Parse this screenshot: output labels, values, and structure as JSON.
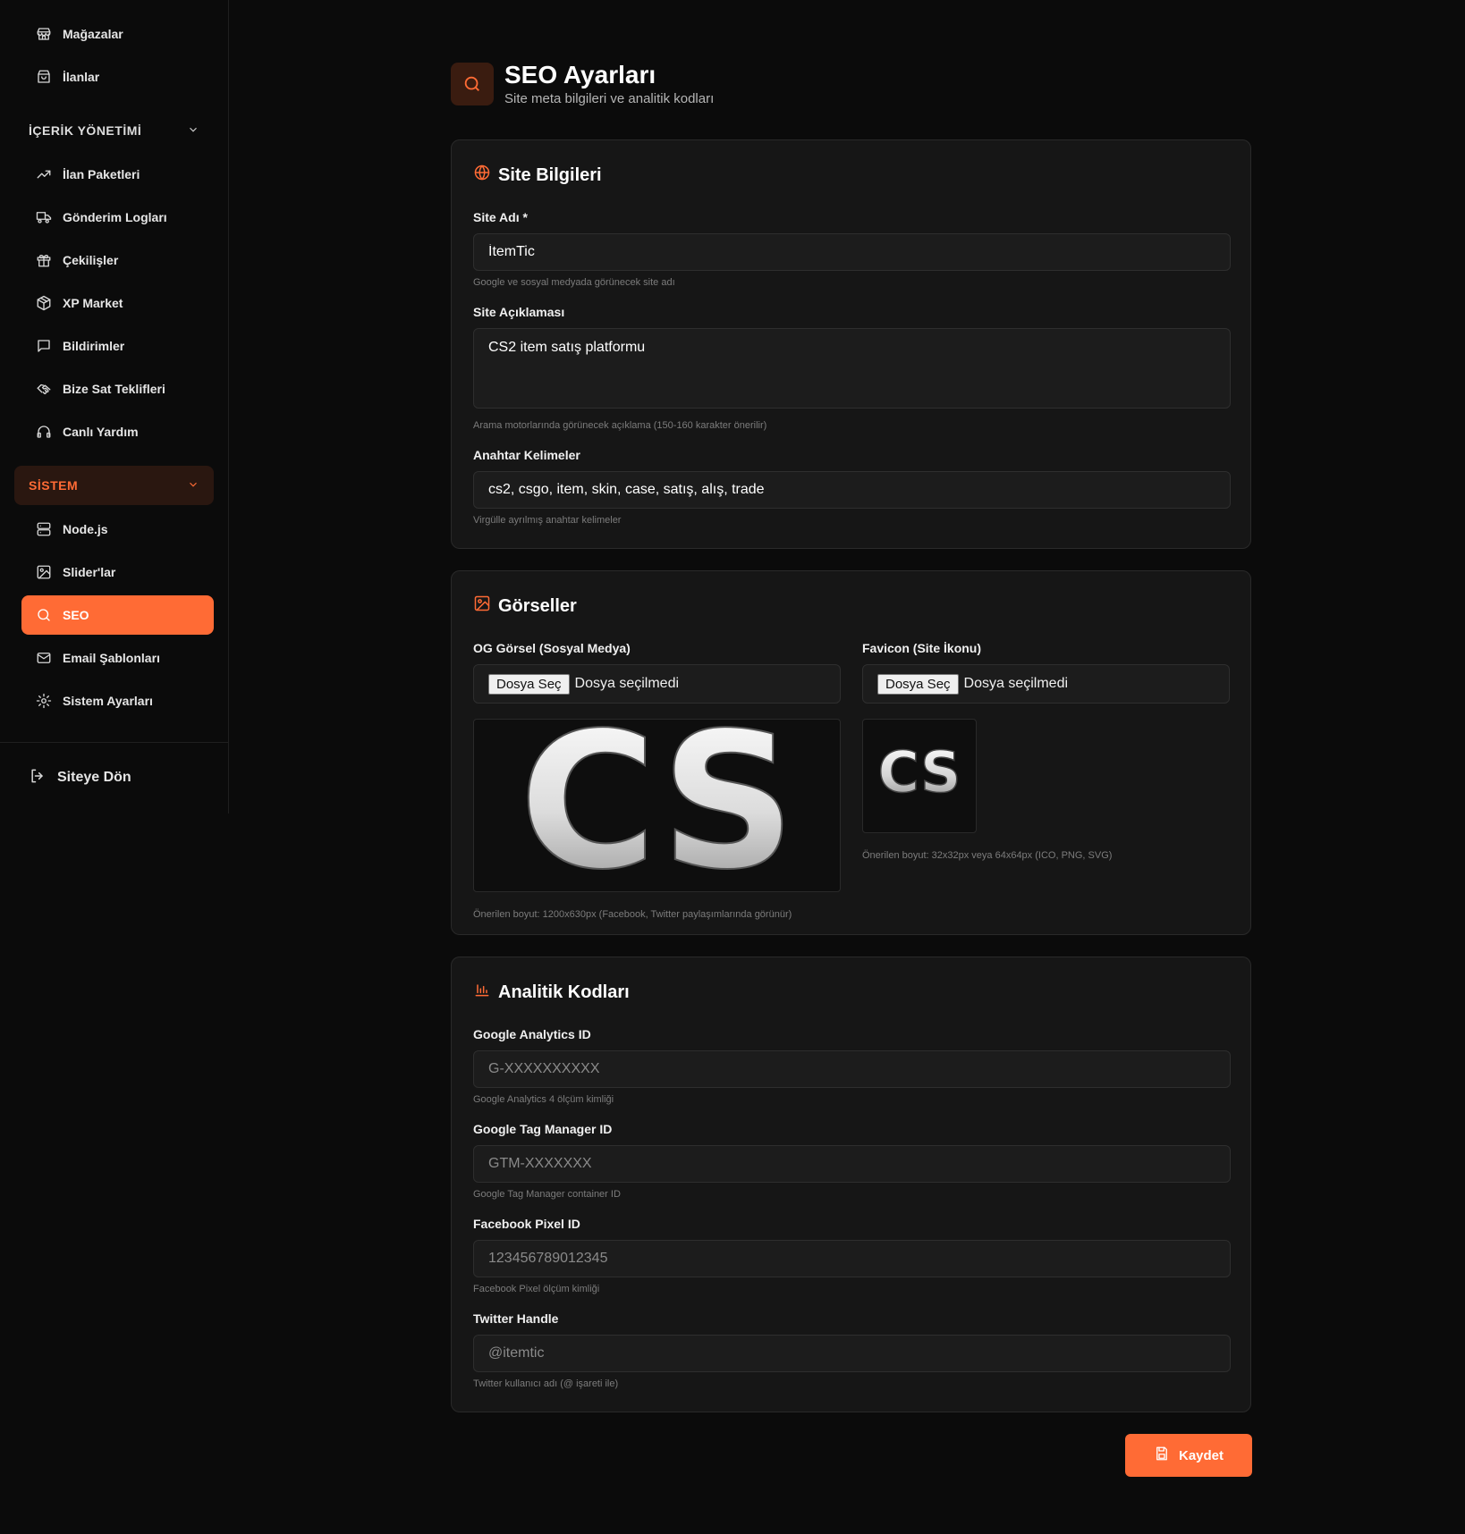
{
  "sidebar": {
    "top_items": [
      {
        "label": "Mağazalar",
        "icon": "store-icon"
      },
      {
        "label": "İlanlar",
        "icon": "shopping-bag-icon"
      }
    ],
    "content_section": {
      "title": "İÇERİK YÖNETİMİ",
      "items": [
        {
          "label": "İlan Paketleri",
          "icon": "trending-up-icon"
        },
        {
          "label": "Gönderim Logları",
          "icon": "truck-icon"
        },
        {
          "label": "Çekilişler",
          "icon": "gift-icon"
        },
        {
          "label": "XP Market",
          "icon": "package-icon"
        },
        {
          "label": "Bildirimler",
          "icon": "message-square-icon"
        },
        {
          "label": "Bize Sat Teklifleri",
          "icon": "handshake-icon"
        },
        {
          "label": "Canlı Yardım",
          "icon": "headphones-icon"
        }
      ]
    },
    "system_section": {
      "title": "SİSTEM",
      "items": [
        {
          "label": "Node.js",
          "icon": "server-icon"
        },
        {
          "label": "Slider'lar",
          "icon": "image-icon"
        },
        {
          "label": "SEO",
          "icon": "search-icon",
          "active": true
        },
        {
          "label": "Email Şablonları",
          "icon": "mail-icon"
        },
        {
          "label": "Sistem Ayarları",
          "icon": "settings-icon"
        }
      ]
    },
    "back_link": "Siteye Dön"
  },
  "header": {
    "title": "SEO Ayarları",
    "subtitle": "Site meta bilgileri ve analitik kodları"
  },
  "site_info": {
    "title": "Site Bilgileri",
    "site_name": {
      "label": "Site Adı *",
      "value": "İtemTic",
      "hint": "Google ve sosyal medyada görünecek site adı"
    },
    "site_description": {
      "label": "Site Açıklaması",
      "value": "CS2 item satış platformu",
      "hint": "Arama motorlarında görünecek açıklama (150-160 karakter önerilir)"
    },
    "keywords": {
      "label": "Anahtar Kelimeler",
      "value": "cs2, csgo, item, skin, case, satış, alış, trade",
      "hint": "Virgülle ayrılmış anahtar kelimeler"
    }
  },
  "images": {
    "title": "Görseller",
    "og_image": {
      "label": "OG Görsel (Sosyal Medya)",
      "button": "Dosya Seç",
      "status": "Dosya seçilmedi",
      "preview_text": "CS",
      "hint": "Önerilen boyut: 1200x630px (Facebook, Twitter paylaşımlarında görünür)"
    },
    "favicon": {
      "label": "Favicon (Site İkonu)",
      "button": "Dosya Seç",
      "status": "Dosya seçilmedi",
      "preview_text": "CS",
      "hint": "Önerilen boyut: 32x32px veya 64x64px (ICO, PNG, SVG)"
    }
  },
  "analytics": {
    "title": "Analitik Kodları",
    "ga": {
      "label": "Google Analytics ID",
      "value": "",
      "placeholder": "G-XXXXXXXXXX",
      "hint": "Google Analytics 4 ölçüm kimliği"
    },
    "gtm": {
      "label": "Google Tag Manager ID",
      "value": "",
      "placeholder": "GTM-XXXXXXX",
      "hint": "Google Tag Manager container ID"
    },
    "fb": {
      "label": "Facebook Pixel ID",
      "value": "",
      "placeholder": "123456789012345",
      "hint": "Facebook Pixel ölçüm kimliği"
    },
    "twitter": {
      "label": "Twitter Handle",
      "value": "",
      "placeholder": "@itemtic",
      "hint": "Twitter kullanıcı adı (@ işareti ile)"
    }
  },
  "save_button": "Kaydet",
  "colors": {
    "accent": "#ff6b35",
    "background": "#0b0b0b",
    "card": "#161616"
  }
}
